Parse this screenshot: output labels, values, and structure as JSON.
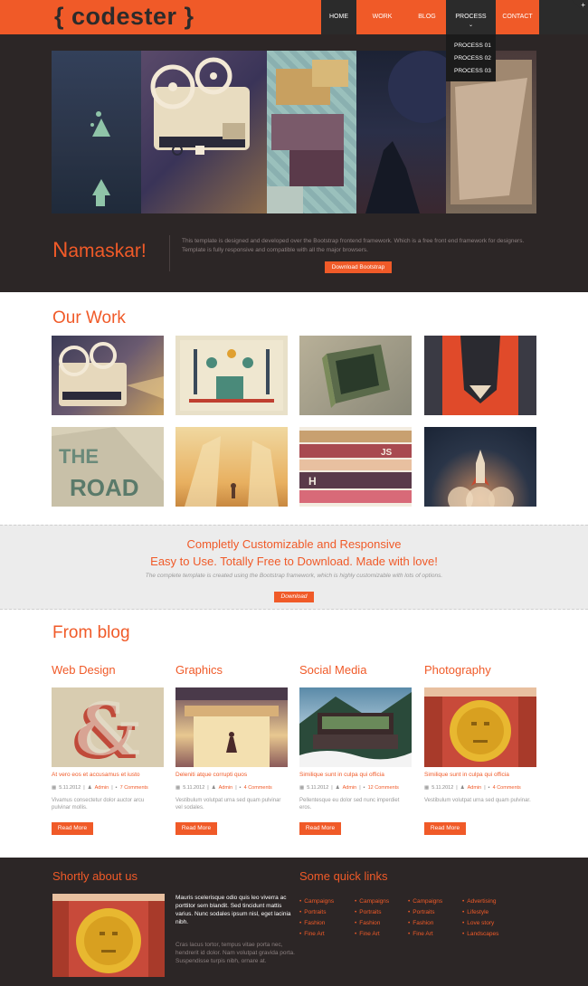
{
  "brand": {
    "logo": "{ codester }",
    "color": "#f05a28",
    "dark": "#2b2b2b"
  },
  "nav": {
    "items": [
      {
        "label": "HOME"
      },
      {
        "label": "WORK"
      },
      {
        "label": "BLOG"
      },
      {
        "label": "PROCESS"
      },
      {
        "label": "CONTACT"
      }
    ],
    "dropdown": [
      "PROCESS 01",
      "PROCESS 02",
      "PROCESS 03"
    ]
  },
  "hero": {
    "title_first": "N",
    "title_rest": "amaskar!",
    "text": "This template is designed and developed over the Bootstrap frontend framework. Which is a free front end framework for designers. Template is fully responsive and compatible with all the major browsers.",
    "button": "Download Bootstrap"
  },
  "work": {
    "title": "Our Work"
  },
  "banner": {
    "line1": "Completly Customizable and Responsive",
    "line2": "Easy to Use. Totally Free to Download. Made with love!",
    "line3": "The complete template is created using the Bootstrap framework, which is highly customizable with lots of options.",
    "button": "Download"
  },
  "blog": {
    "title": "From blog",
    "posts": [
      {
        "title": "Web Design",
        "subtitle": "At vero eos et accusamus et iusto",
        "date": "5.11.2012",
        "author": "Admin",
        "comments": "7 Comments",
        "desc": "Vivamus consectetur dolor auctor arcu pulvinar mollis.",
        "button": "Read More"
      },
      {
        "title": "Graphics",
        "subtitle": "Deleniti atque corrupti quos",
        "date": "5.11.2012",
        "author": "Admin",
        "comments": "4 Comments",
        "desc": "Vestibulum volutpat urna sed quam pulvinar vel sodales.",
        "button": "Read More"
      },
      {
        "title": "Social Media",
        "subtitle": "Similique sunt in culpa qui officia",
        "date": "5.11.2012",
        "author": "Admin",
        "comments": "12 Comments",
        "desc": "Pellentesque eu dolor sed nunc imperdiet eros.",
        "button": "Read More"
      },
      {
        "title": "Photography",
        "subtitle": "Similique sunt in culpa qui officia",
        "date": "5.11.2012",
        "author": "Admin",
        "comments": "4 Comments",
        "desc": "Vestibulum volutpat urna sed quam pulvinar.",
        "button": "Read More"
      }
    ]
  },
  "footer": {
    "about_title": "Shortly about us",
    "about_text": "Mauris scelerisque odio quis leo viverra ac porttitor sem blandit. Sed tincidunt mattis varius. Nunc sodales ipsum nisl, eget lacinia nibh.",
    "about_text2": "Cras lacus tortor, tempus vitae porta nec, hendrerit id dolor. Nam volutpat gravida porta. Suspendisse turpis nibh, ornare at.",
    "links_title": "Some quick links",
    "links": [
      "Campaigns",
      "Campaigns",
      "Campaigns",
      "Advertising",
      "Portraits",
      "Portraits",
      "Portraits",
      "Lifestyle",
      "Fashion",
      "Fashion",
      "Fashion",
      "Love story",
      "Fine Art",
      "Fine Art",
      "Fine Art",
      "Landscapes"
    ]
  }
}
